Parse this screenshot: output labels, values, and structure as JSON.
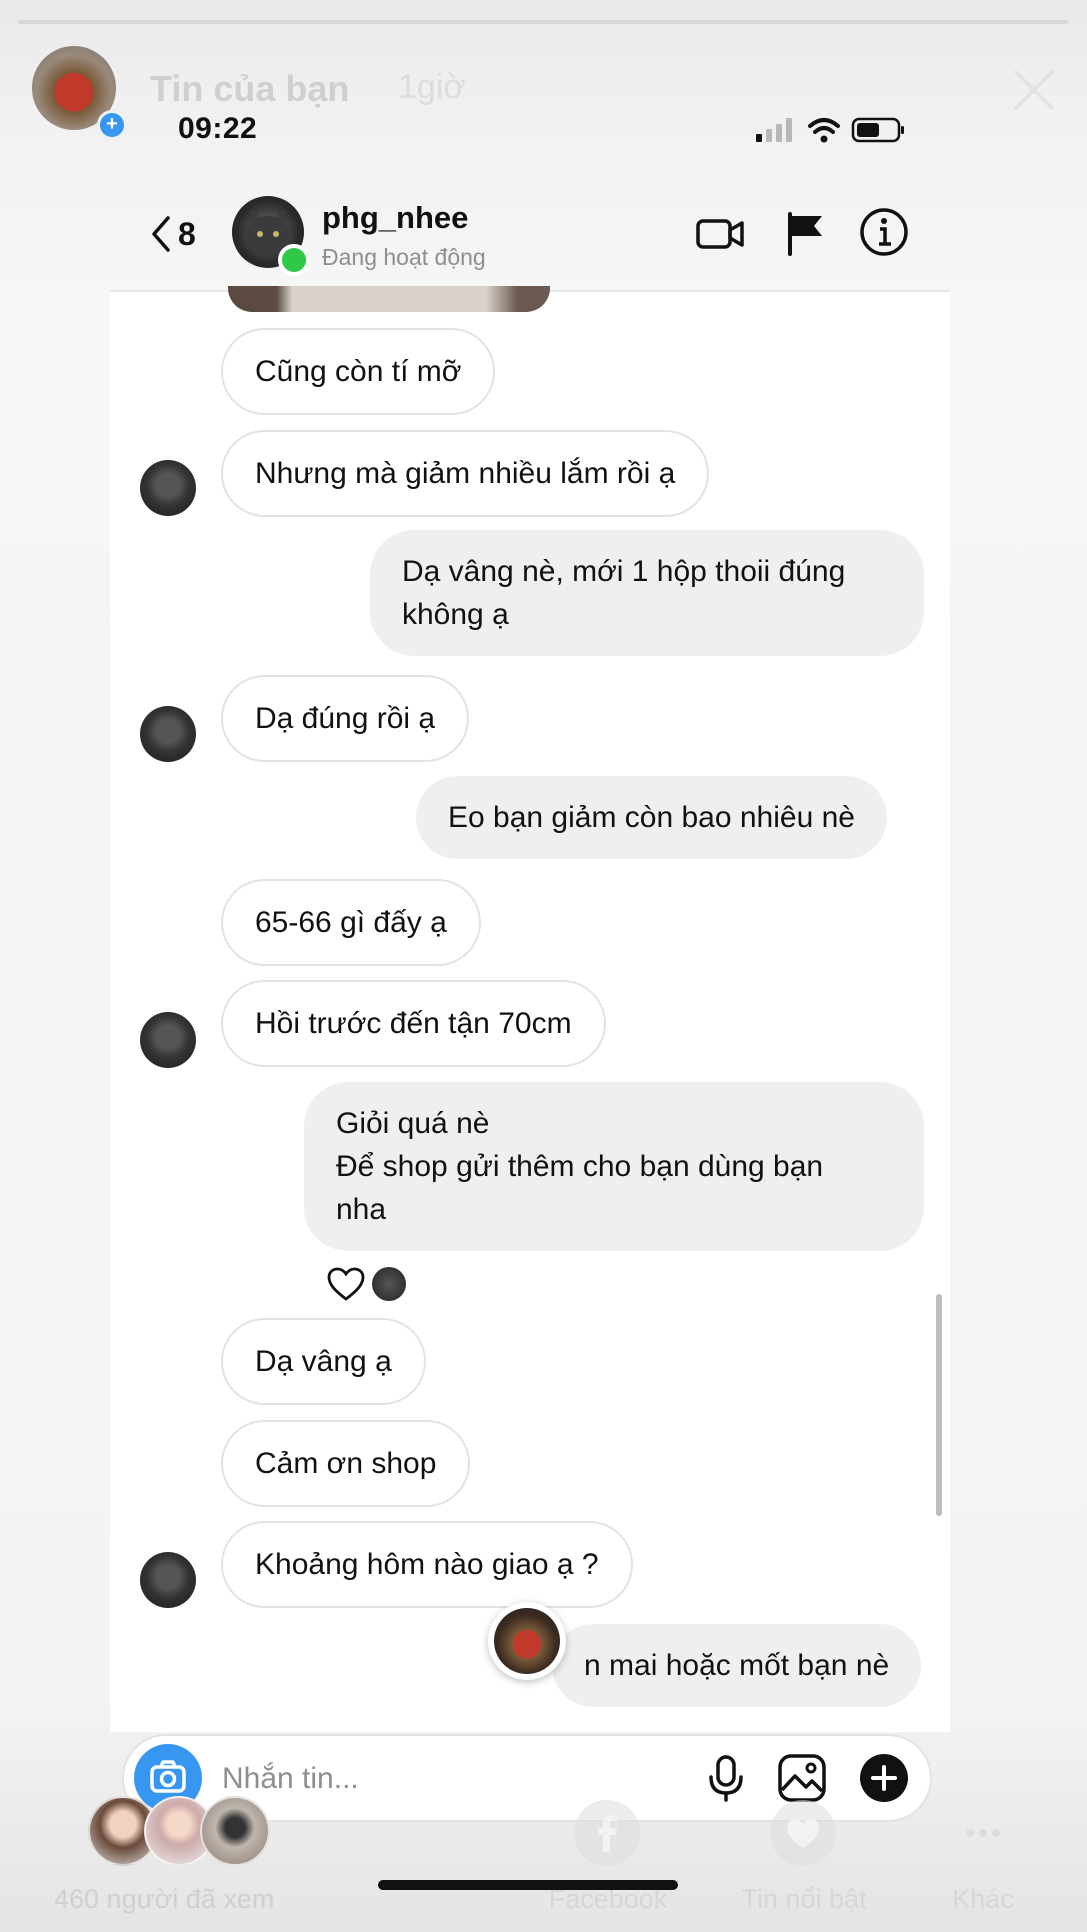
{
  "story": {
    "title": "Tin của bạn",
    "time": "1giờ",
    "viewers_text": "460 người đã xem",
    "actions": [
      {
        "label": "Facebook",
        "icon": "facebook-icon"
      },
      {
        "label": "Tin nổi bật",
        "icon": "heart-highlight-icon"
      },
      {
        "label": "Khác",
        "icon": "more-icon"
      }
    ]
  },
  "status_bar": {
    "time": "09:22"
  },
  "header": {
    "back_count": "8",
    "name": "phg_nhee",
    "status": "Đang hoạt động"
  },
  "messages": [
    {
      "side": "recv",
      "text": "Cũng còn tí mỡ"
    },
    {
      "side": "recv",
      "text": "Nhưng mà giảm nhiều lắm rồi ạ"
    },
    {
      "side": "sent",
      "text": "Dạ vâng nè, mới 1 hộp thoii đúng\nkhông ạ"
    },
    {
      "side": "recv",
      "text": "Dạ đúng rồi ạ"
    },
    {
      "side": "sent",
      "text": "Eo bạn giảm còn bao nhiêu nè"
    },
    {
      "side": "recv",
      "text": "65-66 gì đấy ạ"
    },
    {
      "side": "recv",
      "text": "Hồi trước đến tận 70cm"
    },
    {
      "side": "sent",
      "text": "Giỏi quá nè\nĐể shop gửi thêm cho bạn dùng  bạn\nnha"
    },
    {
      "side": "recv",
      "text": "Dạ vâng ạ"
    },
    {
      "side": "recv",
      "text": "Cảm ơn shop"
    },
    {
      "side": "recv",
      "text": "Khoảng hôm nào giao ạ ?"
    },
    {
      "side": "sent",
      "text": "n mai hoặc mốt bạn nè"
    }
  ],
  "composer": {
    "placeholder": "Nhắn tin..."
  },
  "colors": {
    "accent": "#3797f0",
    "online": "#2ec946",
    "sent_bubble": "#efefef"
  }
}
